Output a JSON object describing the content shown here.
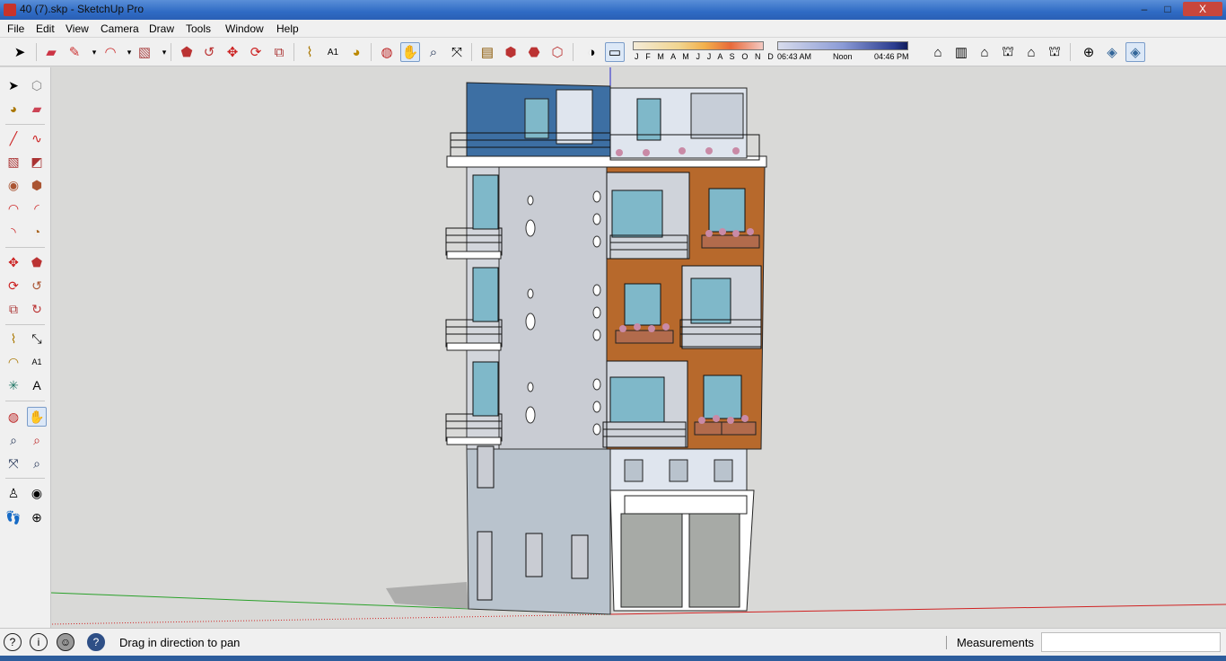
{
  "window": {
    "title": "40 (7).skp - SketchUp Pro",
    "controls": {
      "minimize": "–",
      "restore": "□",
      "close": "X"
    }
  },
  "menu": [
    "File",
    "Edit",
    "View",
    "Camera",
    "Draw",
    "Tools",
    "Window",
    "Help"
  ],
  "toolbar": {
    "months": "J F M A M J J A S O N D",
    "time_start": "06:43 AM",
    "time_noon": "Noon",
    "time_end": "04:46 PM"
  },
  "status": {
    "text": "Drag in direction to pan",
    "measurements_label": "Measurements",
    "measurements_value": ""
  },
  "colors": {
    "accent": "#2f6bc4",
    "orange_facade": "#b7692c",
    "blue_wall": "#3d6fa3",
    "grey_wall": "#c9ccd3",
    "axis_green": "#2aa12a",
    "axis_red": "#d02222",
    "axis_blue": "#2222cc"
  }
}
